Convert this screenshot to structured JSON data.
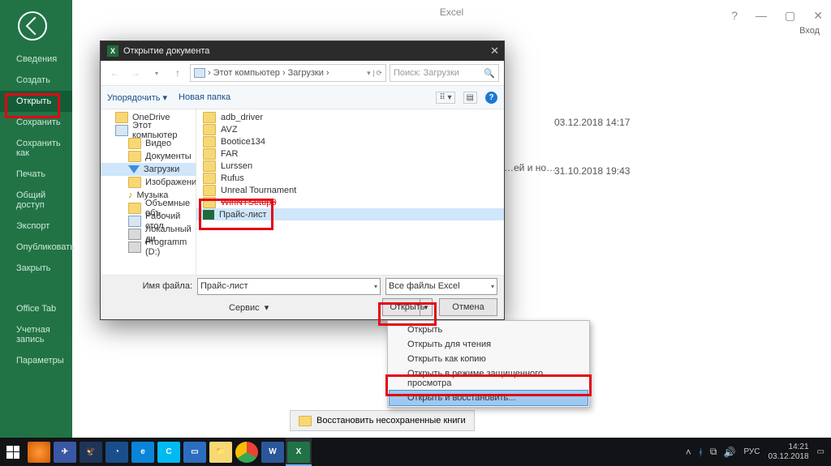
{
  "app_title": "Excel",
  "window_controls": {
    "login": "Вход"
  },
  "backstage": {
    "items": [
      "Сведения",
      "Создать",
      "Открыть",
      "Сохранить",
      "Сохранить как",
      "Печать",
      "Общий доступ",
      "Экспорт",
      "Опубликовать",
      "Закрыть"
    ],
    "secondary": [
      "Office Tab",
      "Учетная запись",
      "Параметры"
    ]
  },
  "bg_rows": [
    {
      "date": "03.12.2018 14:17"
    },
    {
      "text": "…ей и но…",
      "date": "31.10.2018 19:43"
    }
  ],
  "restore_label": "Восстановить несохраненные книги",
  "dialog": {
    "title": "Открытие документа",
    "crumbs": [
      "Этот компьютер",
      "Загрузки"
    ],
    "search_placeholder": "Поиск: Загрузки",
    "toolbar": {
      "organize": "Упорядочить",
      "newfolder": "Новая папка"
    },
    "tree": [
      {
        "label": "OneDrive",
        "icon": "folder",
        "indent": false
      },
      {
        "label": "Этот компьютер",
        "icon": "pc",
        "indent": false
      },
      {
        "label": "Видео",
        "icon": "folder",
        "indent": true
      },
      {
        "label": "Документы",
        "icon": "folder",
        "indent": true
      },
      {
        "label": "Загрузки",
        "icon": "dl",
        "indent": true,
        "selected": true
      },
      {
        "label": "Изображения",
        "icon": "folder",
        "indent": true
      },
      {
        "label": "Музыка",
        "icon": "mus",
        "indent": true
      },
      {
        "label": "Объемные объ",
        "icon": "folder",
        "indent": true
      },
      {
        "label": "Рабочий стол",
        "icon": "pc",
        "indent": true
      },
      {
        "label": "Локальный ди",
        "icon": "disk",
        "indent": true
      },
      {
        "label": "Programm (D:)",
        "icon": "disk",
        "indent": true
      }
    ],
    "files": [
      {
        "label": "adb_driver",
        "icon": "folder"
      },
      {
        "label": "AVZ",
        "icon": "folder"
      },
      {
        "label": "Bootice134",
        "icon": "folder"
      },
      {
        "label": "FAR",
        "icon": "folder"
      },
      {
        "label": "Lurssen",
        "icon": "folder"
      },
      {
        "label": "Rufus",
        "icon": "folder"
      },
      {
        "label": "Unreal Tournament",
        "icon": "folder"
      },
      {
        "label": "WinNTSetup3",
        "icon": "folder"
      },
      {
        "label": "Прайс-лист",
        "icon": "xl",
        "selected": true
      }
    ],
    "filename_label": "Имя файла:",
    "filename_value": "Прайс-лист",
    "filetype_value": "Все файлы Excel",
    "service_label": "Сервис",
    "open_label": "Открыть",
    "cancel_label": "Отмена"
  },
  "open_menu": [
    "Открыть",
    "Открыть для чтения",
    "Открыть как копию",
    "Открыть в режиме защищенного просмотра",
    "Открыть и восстановить..."
  ],
  "taskbar": {
    "lang": "РУС",
    "time": "14:21",
    "date": "03.12.2018"
  }
}
